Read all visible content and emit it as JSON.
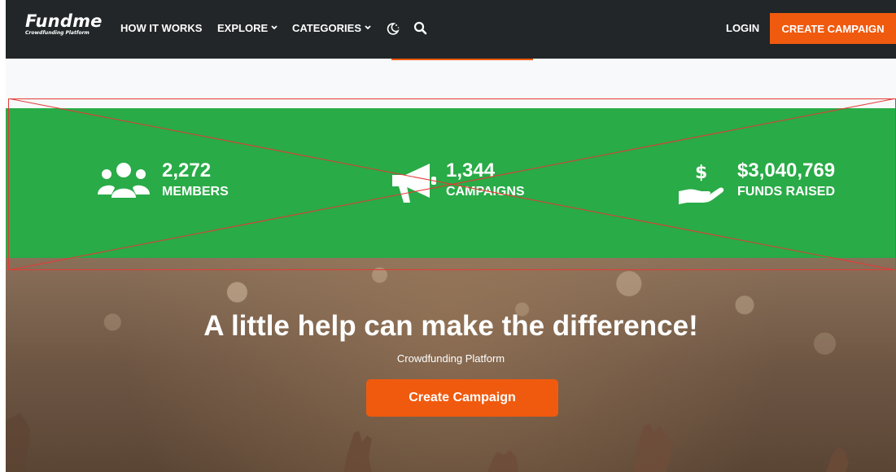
{
  "navbar": {
    "brand_name": "Fundme",
    "brand_tagline": "Crowdfunding Platform",
    "items": [
      {
        "label": "HOW IT WORKS",
        "dropdown": false
      },
      {
        "label": "EXPLORE",
        "dropdown": true
      },
      {
        "label": "CATEGORIES",
        "dropdown": true
      }
    ],
    "theme_icon": "moon-stars-icon",
    "search_icon": "search-icon",
    "login_label": "LOGIN",
    "create_label": "CREATE CAMPAIGN"
  },
  "stats": [
    {
      "icon": "users-icon",
      "value": "2,272",
      "label": "MEMBERS"
    },
    {
      "icon": "megaphone-icon",
      "value": "1,344",
      "label": "CAMPAIGNS"
    },
    {
      "icon": "dollar-hand-icon",
      "value": "$3,040,769",
      "label": "FUNDS RAISED"
    }
  ],
  "hero": {
    "title": "A little help can make the difference!",
    "subtitle": "Crowdfunding Platform",
    "button_label": "Create Campaign"
  },
  "colors": {
    "navbar_bg": "#222629",
    "accent_orange": "#f05a0e",
    "stats_green": "#29ab47",
    "border_red": "#e53935"
  }
}
